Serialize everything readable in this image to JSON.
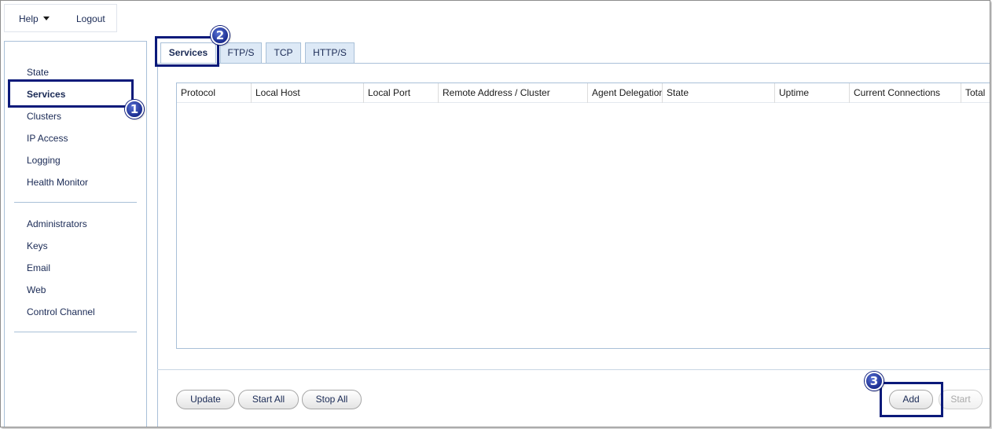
{
  "topmenu": {
    "help_label": "Help",
    "logout_label": "Logout"
  },
  "sidebar": {
    "items": [
      {
        "label": "State"
      },
      {
        "label": "Services"
      },
      {
        "label": "Clusters"
      },
      {
        "label": "IP Access"
      },
      {
        "label": "Logging"
      },
      {
        "label": "Health Monitor"
      },
      {
        "label": "Administrators"
      },
      {
        "label": "Keys"
      },
      {
        "label": "Email"
      },
      {
        "label": "Web"
      },
      {
        "label": "Control Channel"
      }
    ],
    "active": "Services"
  },
  "tabs": [
    {
      "label": "Services"
    },
    {
      "label": "FTP/S"
    },
    {
      "label": "TCP"
    },
    {
      "label": "HTTP/S"
    }
  ],
  "grid": {
    "columns": [
      "Protocol",
      "Local Host",
      "Local Port",
      "Remote Address / Cluster",
      "Agent Delegation",
      "State",
      "Uptime",
      "Current Connections",
      "Total"
    ]
  },
  "buttons": {
    "update": "Update",
    "start_all": "Start All",
    "stop_all": "Stop All",
    "add": "Add",
    "start": "Start"
  },
  "callouts": [
    "1",
    "2",
    "3"
  ],
  "colors": {
    "accent": "#0b1a7a",
    "border": "#a9c0d8",
    "tab_bg": "#dde9f6"
  }
}
